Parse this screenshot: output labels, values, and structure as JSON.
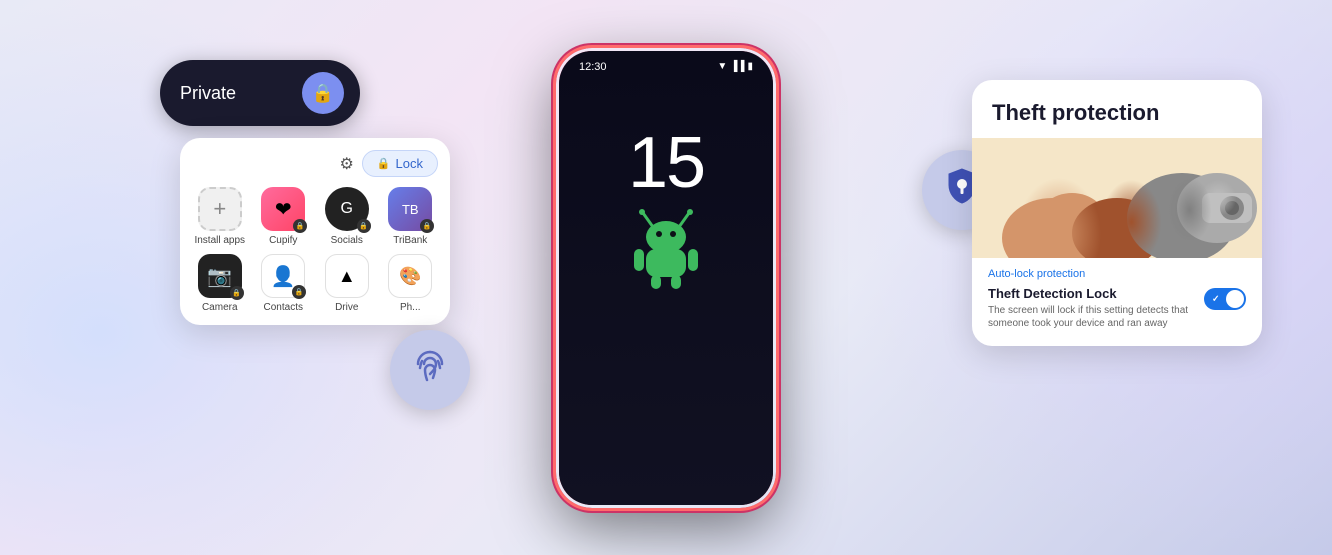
{
  "background": {
    "color_left": "#dde8ff",
    "color_right": "#e8ddff"
  },
  "phone": {
    "status_time": "12:30",
    "clock_number": "15",
    "border_color": "#ff4466"
  },
  "private_space": {
    "pill_label": "Private",
    "lock_circle_color": "#7c8ff0"
  },
  "app_drawer": {
    "lock_button_label": "Lock",
    "apps": [
      {
        "name": "Install apps",
        "type": "install"
      },
      {
        "name": "Cupify",
        "type": "cupify"
      },
      {
        "name": "Socials",
        "type": "socials"
      },
      {
        "name": "TriBank",
        "type": "tribank"
      },
      {
        "name": "Camera",
        "type": "camera"
      },
      {
        "name": "Contacts",
        "type": "contacts"
      },
      {
        "name": "Drive",
        "type": "drive"
      },
      {
        "name": "Photos",
        "type": "photos"
      }
    ]
  },
  "theft_protection": {
    "title": "Theft protection",
    "auto_lock_label": "Auto-lock protection",
    "detection_title": "Theft Detection Lock",
    "detection_desc": "The screen will lock if this setting detects that someone took your device and ran away",
    "toggle_state": "on"
  }
}
